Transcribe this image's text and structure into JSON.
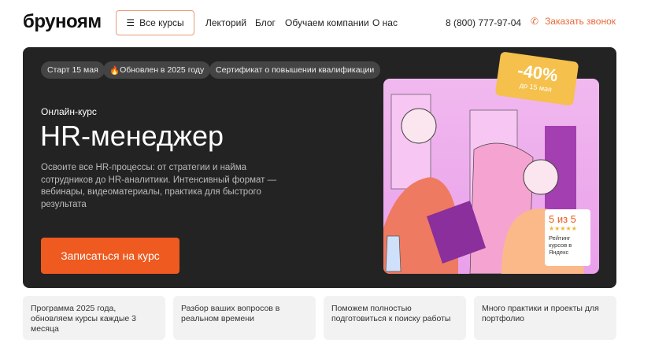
{
  "header": {
    "logo": "бруноям",
    "all_courses": "Все курсы",
    "nav": [
      "Лекторий",
      "Блог",
      "Обучаем компании",
      "О нас"
    ],
    "phone": "8 (800) 777-97-04",
    "callback": "Заказать звонок"
  },
  "hero": {
    "chips": [
      "Старт 15 мая",
      "Обновлен в 2025 году",
      "Сертификат о повышении квалификации"
    ],
    "subtitle": "Онлайн-курс",
    "title": "HR-менеджер",
    "description": "Освоите все HR-процессы: от стратегии и найма сотрудников до HR-аналитики. Интенсивный формат — вебинары, видеоматериалы, практика для быстрого результата",
    "cta": "Записаться на курс",
    "discount": "-40%",
    "discount_until": "до 15 мая",
    "rating": "5 из 5",
    "stars": "★★★★★",
    "rating_label": "Рейтинг курсов в Яндекс"
  },
  "features": [
    "Программа 2025 года, обновляем курсы каждые 3 месяца",
    "Разбор ваших вопросов в реальном времени",
    "Поможем полностью подготовиться к поиску работы",
    "Много практики и проекты для портфолио"
  ],
  "colors": {
    "accent": "#ee5a1f",
    "dark": "#232323",
    "tag": "#f5c04c"
  }
}
